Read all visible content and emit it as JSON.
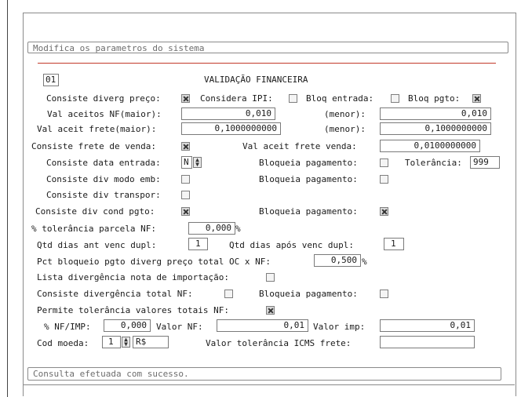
{
  "window": {
    "title": "Modifica os parametros do sistema"
  },
  "section": {
    "code": "01",
    "title": "VALIDAÇÃO FINANCEIRA"
  },
  "labels": {
    "consiste_diverg_preco": "Consiste diverg preço:",
    "considera_ipi": "Considera IPI:",
    "bloq_entrada": "Bloq entrada:",
    "bloq_pgto": "Bloq pgto:",
    "val_aceitos_nf_maior": "Val aceitos NF(maior):",
    "menor_1": "(menor):",
    "val_aceit_frete_maior": "Val aceit frete(maior):",
    "menor_2": "(menor):",
    "consiste_frete_venda": "Consiste frete de venda:",
    "val_aceit_frete_venda": "Val aceit frete venda:",
    "consiste_data_entrada": "Consiste data entrada:",
    "bloqueia_pagamento_1": "Bloqueia pagamento:",
    "tolerancia": "Tolerância:",
    "consiste_div_modo_emb": "Consiste div modo emb:",
    "bloqueia_pagamento_2": "Bloqueia pagamento:",
    "consiste_div_transpor": "Consiste div transpor:",
    "consiste_div_cond_pgto": "Consiste div cond pgto:",
    "bloqueia_pagamento_3": "Bloqueia pagamento:",
    "tolerancia_parcela_nf": "% tolerância parcela NF:",
    "pct_sign_1": "%",
    "qtd_dias_ant": "Qtd dias ant venc dupl:",
    "qtd_dias_apos": "Qtd dias após venc dupl:",
    "pct_bloqueio": "Pct bloqueio pgto diverg preço total OC x NF:",
    "pct_sign_2": "%",
    "lista_div_importacao": "Lista divergência nota de importação:",
    "consiste_div_total_nf": "Consiste divergência total NF:",
    "bloqueia_pagamento_4": "Bloqueia pagamento:",
    "permite_tol_totais": "Permite tolerância valores totais NF:",
    "nf_imp": "% NF/IMP:",
    "valor_nf": "Valor NF:",
    "valor_imp": "Valor imp:",
    "cod_moeda": "Cod moeda:",
    "valor_tol_icms_frete": "Valor tolerância ICMS frete:"
  },
  "values": {
    "val_aceitos_nf_maior": "0,010",
    "val_aceitos_nf_menor": "0,010",
    "val_aceit_frete_maior": "0,1000000000",
    "val_aceit_frete_menor": "0,1000000000",
    "val_aceit_frete_venda": "0,0100000000",
    "consiste_data_entrada": "N",
    "tolerancia": "999",
    "tolerancia_parcela_nf": "0,000",
    "qtd_dias_ant": "1",
    "qtd_dias_apos": "1",
    "pct_bloqueio": "0,500",
    "nf_imp": "0,000",
    "valor_nf": "0,01",
    "valor_imp": "0,01",
    "cod_moeda": "1",
    "moeda_simbolo": "R$",
    "valor_tol_icms_frete": ""
  },
  "checkboxes": {
    "consiste_diverg_preco": true,
    "considera_ipi": false,
    "bloq_entrada": false,
    "bloq_pgto": true,
    "consiste_frete_venda": true,
    "bloqueia_pagamento_1": false,
    "consiste_div_modo_emb": false,
    "bloqueia_pagamento_2": false,
    "consiste_div_transpor": false,
    "consiste_div_cond_pgto": true,
    "bloqueia_pagamento_3": true,
    "lista_div_importacao": false,
    "consiste_div_total_nf": false,
    "bloqueia_pagamento_4": false,
    "permite_tol_totais": true
  },
  "status": {
    "message": "Consulta efetuada com sucesso."
  }
}
